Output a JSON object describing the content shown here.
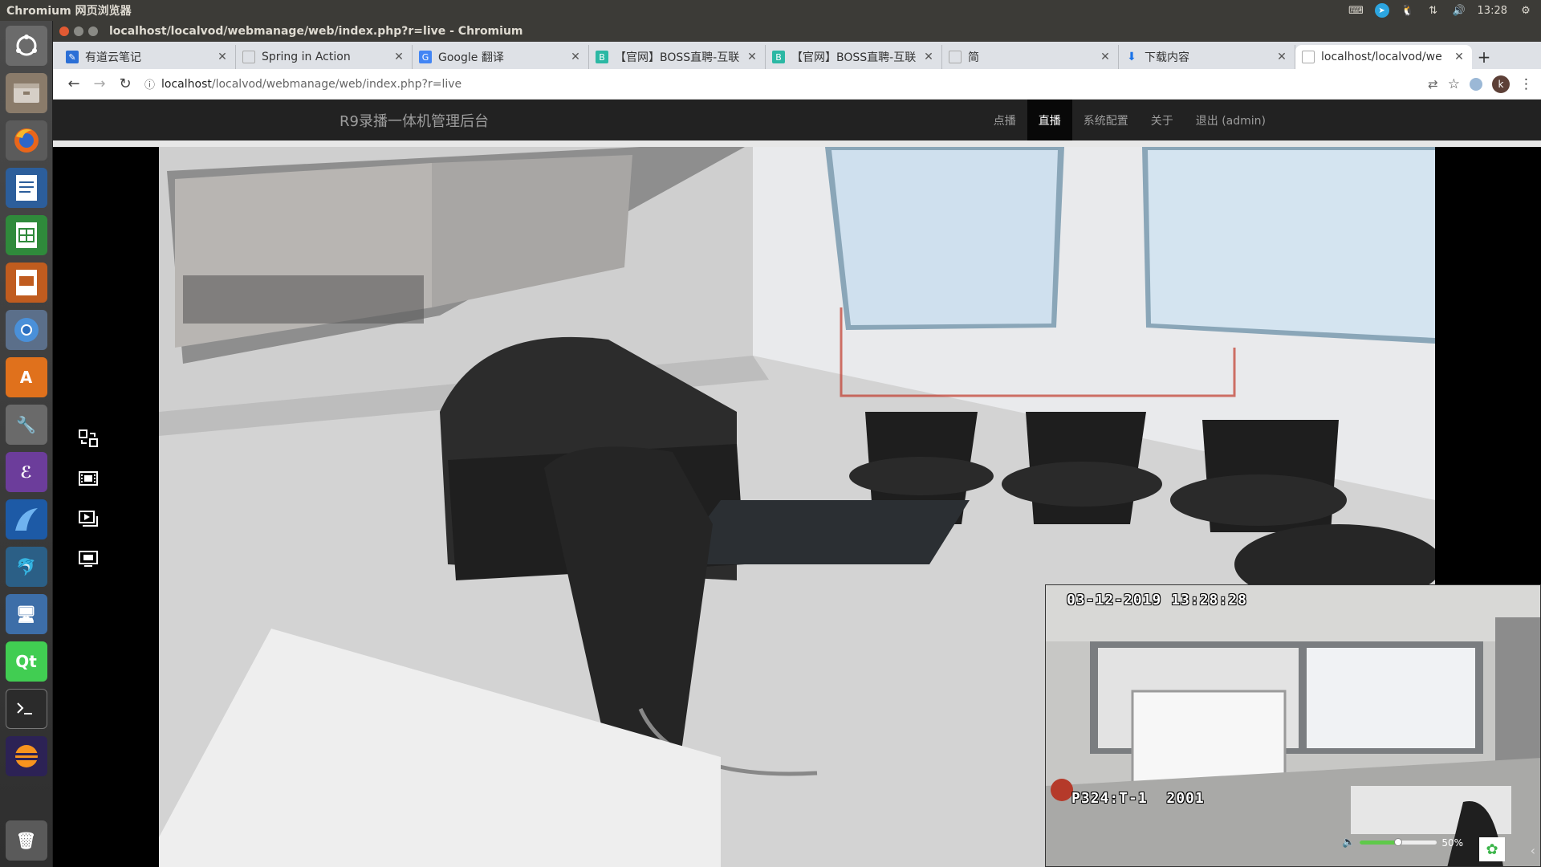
{
  "top_panel": {
    "app_title": "Chromium 网页浏览器",
    "time": "13:28"
  },
  "window": {
    "title": "localhost/localvod/webmanage/web/index.php?r=live - Chromium"
  },
  "tabs": [
    {
      "label": "有道云笔记",
      "icon": "youdao-note-icon",
      "color": "#2b6fd6"
    },
    {
      "label": "Spring in Action",
      "icon": "document-icon",
      "color": ""
    },
    {
      "label": "Google 翻译",
      "icon": "google-translate-icon",
      "color": "#4285f4"
    },
    {
      "label": "【官网】BOSS直聘-互联",
      "icon": "boss-icon",
      "color": "#2bb8a4"
    },
    {
      "label": "【官网】BOSS直聘-互联",
      "icon": "boss-icon",
      "color": "#2bb8a4"
    },
    {
      "label": "简",
      "icon": "document-icon",
      "color": ""
    },
    {
      "label": "下载内容",
      "icon": "download-icon",
      "color": "#1a73e8"
    },
    {
      "label": "localhost/localvod/we",
      "icon": "document-icon",
      "color": ""
    }
  ],
  "address_bar": {
    "host": "localhost",
    "path": "/localvod/webmanage/web/index.php?r=live"
  },
  "navbar": {
    "brand": "R9录播一体机管理后台",
    "links": [
      "点播",
      "直播",
      "系统配置",
      "关于",
      "退出 (admin)"
    ],
    "active_index": 1
  },
  "pip_video": {
    "timestamp": "03-12-2019 13:28:28",
    "channel": "P324:T-1  2001",
    "volume_label": "50%",
    "volume_level": 0.5
  },
  "colors": {
    "navbar_bg": "#222222",
    "volume_fill": "#5fc94a"
  }
}
